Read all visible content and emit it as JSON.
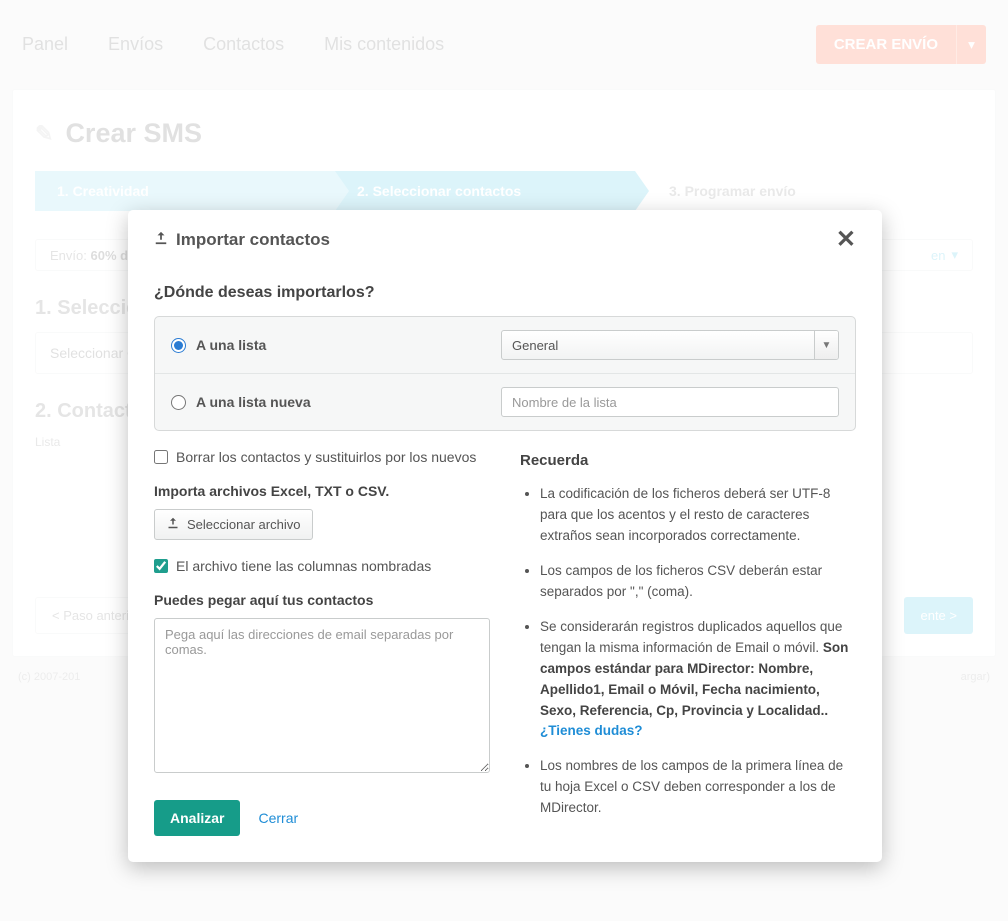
{
  "nav": {
    "items": [
      "Panel",
      "Envíos",
      "Contactos",
      "Mis contenidos"
    ],
    "create_label": "CREAR ENVÍO"
  },
  "page": {
    "title": "Crear SMS",
    "steps": {
      "s1": "1. Creatividad",
      "s2": "2. Seleccionar contactos",
      "s3": "3. Programar envío"
    },
    "envio_prefix": "Envío:",
    "envio_value": "60% d",
    "envio_right": "en",
    "section1": "1. Seleccio",
    "select_placeholder": "Seleccionar Co",
    "section2": "2. Contacto",
    "list_label": "Lista",
    "prev": "< Paso anterior",
    "next": "ente >"
  },
  "footer": {
    "left": "(c) 2007-201",
    "right": "argar)"
  },
  "modal": {
    "title": "Importar contactos",
    "question": "¿Dónde deseas importarlos?",
    "radio_existing": "A una lista",
    "existing_value": "General",
    "radio_new": "A una lista nueva",
    "new_placeholder": "Nombre de la lista",
    "delete_label": "Borrar los contactos y sustituirlos por los nuevos",
    "import_title": "Importa archivos Excel, TXT o CSV.",
    "select_file": "Seleccionar archivo",
    "columns_named": "El archivo tiene las columnas nombradas",
    "paste_title": "Puedes pegar aquí tus contactos",
    "paste_placeholder": "Pega aquí las direcciones de email separadas por comas.",
    "reminder_title": "Recuerda",
    "r1": "La codificación de los ficheros deberá ser UTF-8 para que los acentos y el resto de caracteres extraños sean incorporados correctamente.",
    "r2": "Los campos de los ficheros CSV deberán estar separados por \",\" (coma).",
    "r3a": "Se considerarán registros duplicados aquellos que tengan la misma información de Email o móvil. ",
    "r3b": "Son campos estándar para MDirector: Nombre, Apellido1, Email o Móvil, Fecha nacimiento, Sexo, Referencia, Cp, Provincia y Localidad..",
    "r3link": " ¿Tienes dudas?",
    "r4": "Los nombres de los campos de la primera línea de tu hoja Excel o CSV deben corresponder a los de MDirector.",
    "analyze": "Analizar",
    "close": "Cerrar"
  }
}
